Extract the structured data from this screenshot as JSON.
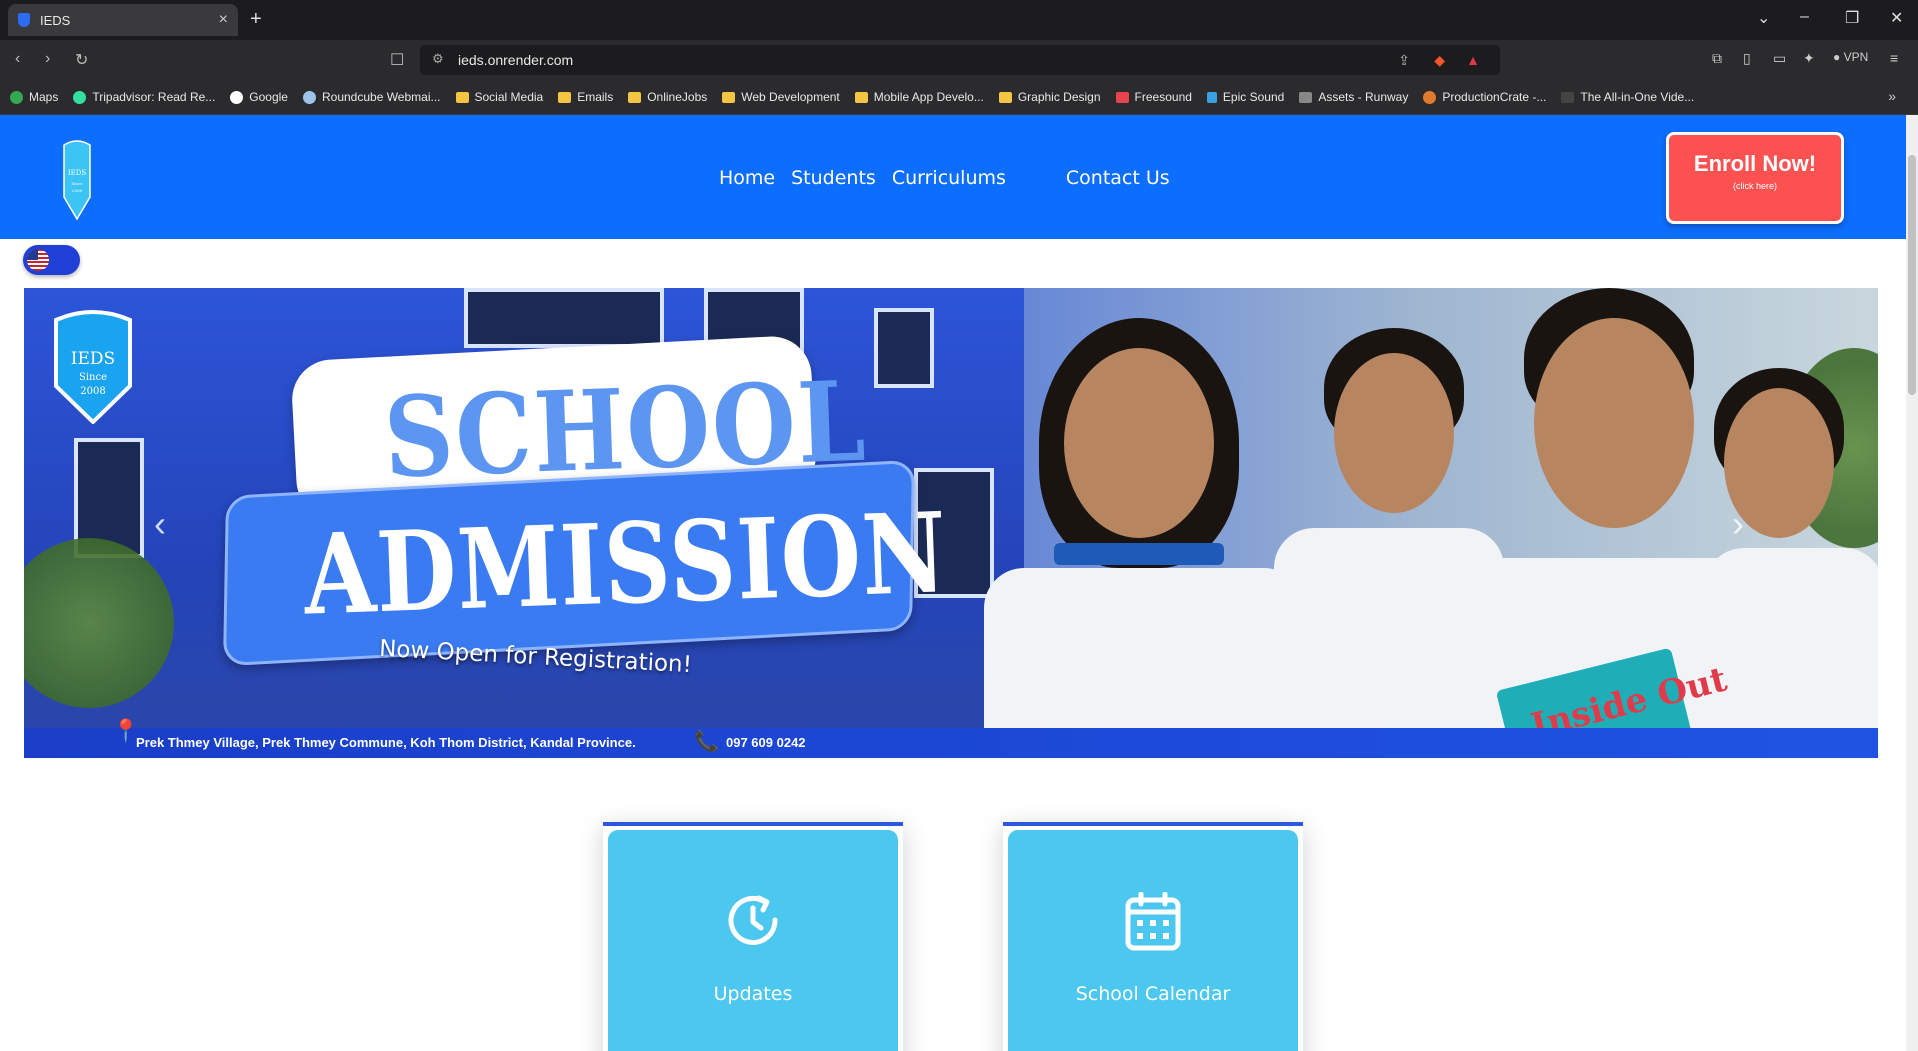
{
  "browser": {
    "tab_title": "IEDS",
    "tab_close": "×",
    "new_tab": "+",
    "url": "ieds.onrender.com",
    "vpn_label": "VPN",
    "bookmarks": [
      {
        "label": "Maps",
        "icon": "map-pin-icon"
      },
      {
        "label": "Tripadvisor: Read Re...",
        "icon": "tripadvisor-icon"
      },
      {
        "label": "Google",
        "icon": "google-icon"
      },
      {
        "label": "Roundcube Webmai...",
        "icon": "roundcube-icon"
      },
      {
        "label": "Social Media",
        "icon": "folder-icon"
      },
      {
        "label": "Emails",
        "icon": "folder-icon"
      },
      {
        "label": "OnlineJobs",
        "icon": "folder-icon"
      },
      {
        "label": "Web Development",
        "icon": "folder-icon"
      },
      {
        "label": "Mobile App Develo...",
        "icon": "folder-icon"
      },
      {
        "label": "Graphic Design",
        "icon": "folder-icon"
      },
      {
        "label": "Freesound",
        "icon": "freesound-icon"
      },
      {
        "label": "Epic Sound",
        "icon": "epic-sound-icon"
      },
      {
        "label": "Assets - Runway",
        "icon": "runway-icon"
      },
      {
        "label": "ProductionCrate -...",
        "icon": "productioncrate-icon"
      },
      {
        "label": "The All-in-One Vide...",
        "icon": "video-icon"
      }
    ]
  },
  "site": {
    "nav": {
      "home": "Home",
      "students": "Students",
      "curriculums": "Curriculums",
      "contact": "Contact Us"
    },
    "enroll": {
      "title": "Enroll Now!",
      "subtitle": "(click here)"
    },
    "logo_text": {
      "name": "IEDS",
      "since": "Since",
      "year": "2008"
    },
    "banner": {
      "headline_1": "SCHOOL",
      "headline_2": "ADMISSION",
      "tagline": "Now Open for Registration!",
      "address": "Prek Thmey Village, Prek Thmey Commune, Koh Thom District, Kandal Province.",
      "phone": "097 609 0242",
      "book_text": "Inside Out",
      "prev_arrow": "‹",
      "next_arrow": "›"
    },
    "cards": [
      {
        "label": "Updates",
        "icon": "clock-refresh-icon"
      },
      {
        "label": "School Calendar",
        "icon": "calendar-icon"
      }
    ]
  },
  "colors": {
    "header_blue": "#0d6efd",
    "enroll_red": "#fb5151",
    "card_cyan": "#4cc8f0"
  }
}
